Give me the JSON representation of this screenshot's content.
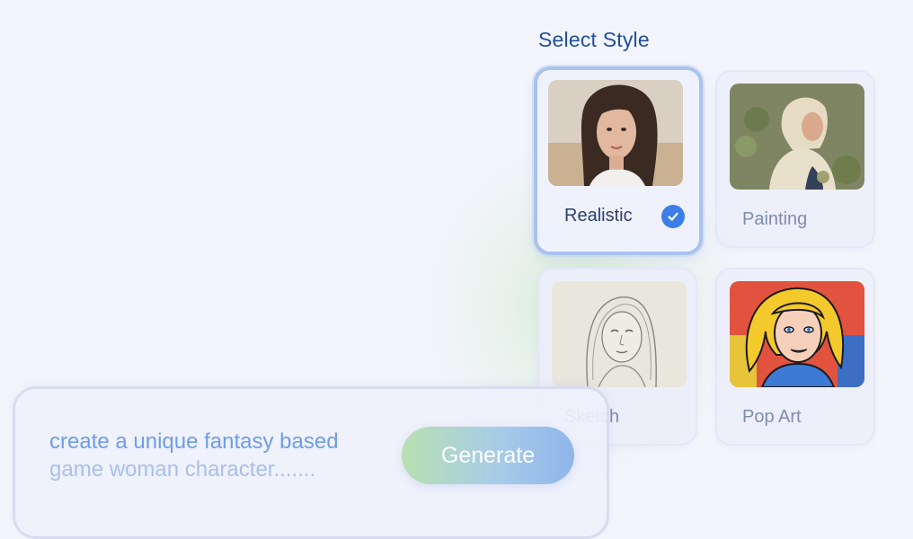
{
  "style_selector": {
    "title": "Select Style",
    "options": [
      {
        "label": "Realistic",
        "selected": true
      },
      {
        "label": "Painting",
        "selected": false
      },
      {
        "label": "Sketch",
        "selected": false
      },
      {
        "label": "Pop Art",
        "selected": false
      }
    ]
  },
  "prompt": {
    "line1": "create a unique fantasy based",
    "line2": "game woman character.......",
    "generate_label": "Generate"
  },
  "colors": {
    "accent": "#3b7fe6",
    "title": "#1f4f9e",
    "prompt_text": "#6e9de8",
    "selected_border": "#a9c2ee"
  },
  "icons": {
    "selected_marker": "check-circle-icon"
  }
}
